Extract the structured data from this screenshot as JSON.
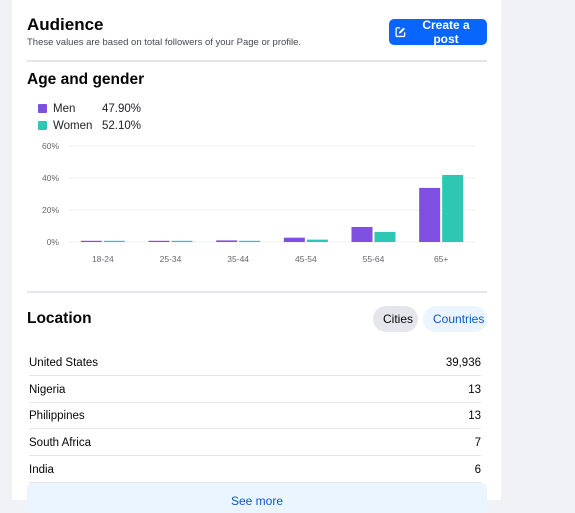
{
  "audience": {
    "title": "Audience",
    "subtitle": "These values are based on total followers of your Page or profile.",
    "create_post_label": "Create a post",
    "create_post_icon": "edit-square-icon"
  },
  "age_gender": {
    "title": "Age and gender",
    "legend": [
      {
        "label": "Men",
        "value": "47.90%",
        "color": "#7f4fe2"
      },
      {
        "label": "Women",
        "value": "52.10%",
        "color": "#2ec7b3"
      }
    ]
  },
  "chart_data": {
    "type": "bar",
    "title": "Age and gender",
    "xlabel": "",
    "ylabel": "",
    "categories": [
      "18-24",
      "25-34",
      "35-44",
      "45-54",
      "55-64",
      "65+"
    ],
    "series": [
      {
        "name": "Men",
        "color": "#7f4fe2",
        "values": [
          0.3,
          0.3,
          1.0,
          2.7,
          9.4,
          33.8
        ]
      },
      {
        "name": "Women",
        "color": "#2ec7b3",
        "values": [
          0.3,
          0.3,
          0.6,
          1.5,
          6.3,
          41.9
        ]
      }
    ],
    "yticks": [
      "0%",
      "20%",
      "40%",
      "60%"
    ],
    "ytick_values": [
      0,
      20,
      40,
      60
    ],
    "ylim": [
      0,
      60
    ],
    "grid": true,
    "legend_position": "top-left"
  },
  "location": {
    "title": "Location",
    "toggles": [
      {
        "label": "Cities",
        "selected": false
      },
      {
        "label": "Countries",
        "selected": true
      }
    ],
    "rows": [
      {
        "name": "United States",
        "value": "39,936"
      },
      {
        "name": "Nigeria",
        "value": "13"
      },
      {
        "name": "Philippines",
        "value": "13"
      },
      {
        "name": "South Africa",
        "value": "7"
      },
      {
        "name": "India",
        "value": "6"
      }
    ],
    "see_more_label": "See more"
  }
}
